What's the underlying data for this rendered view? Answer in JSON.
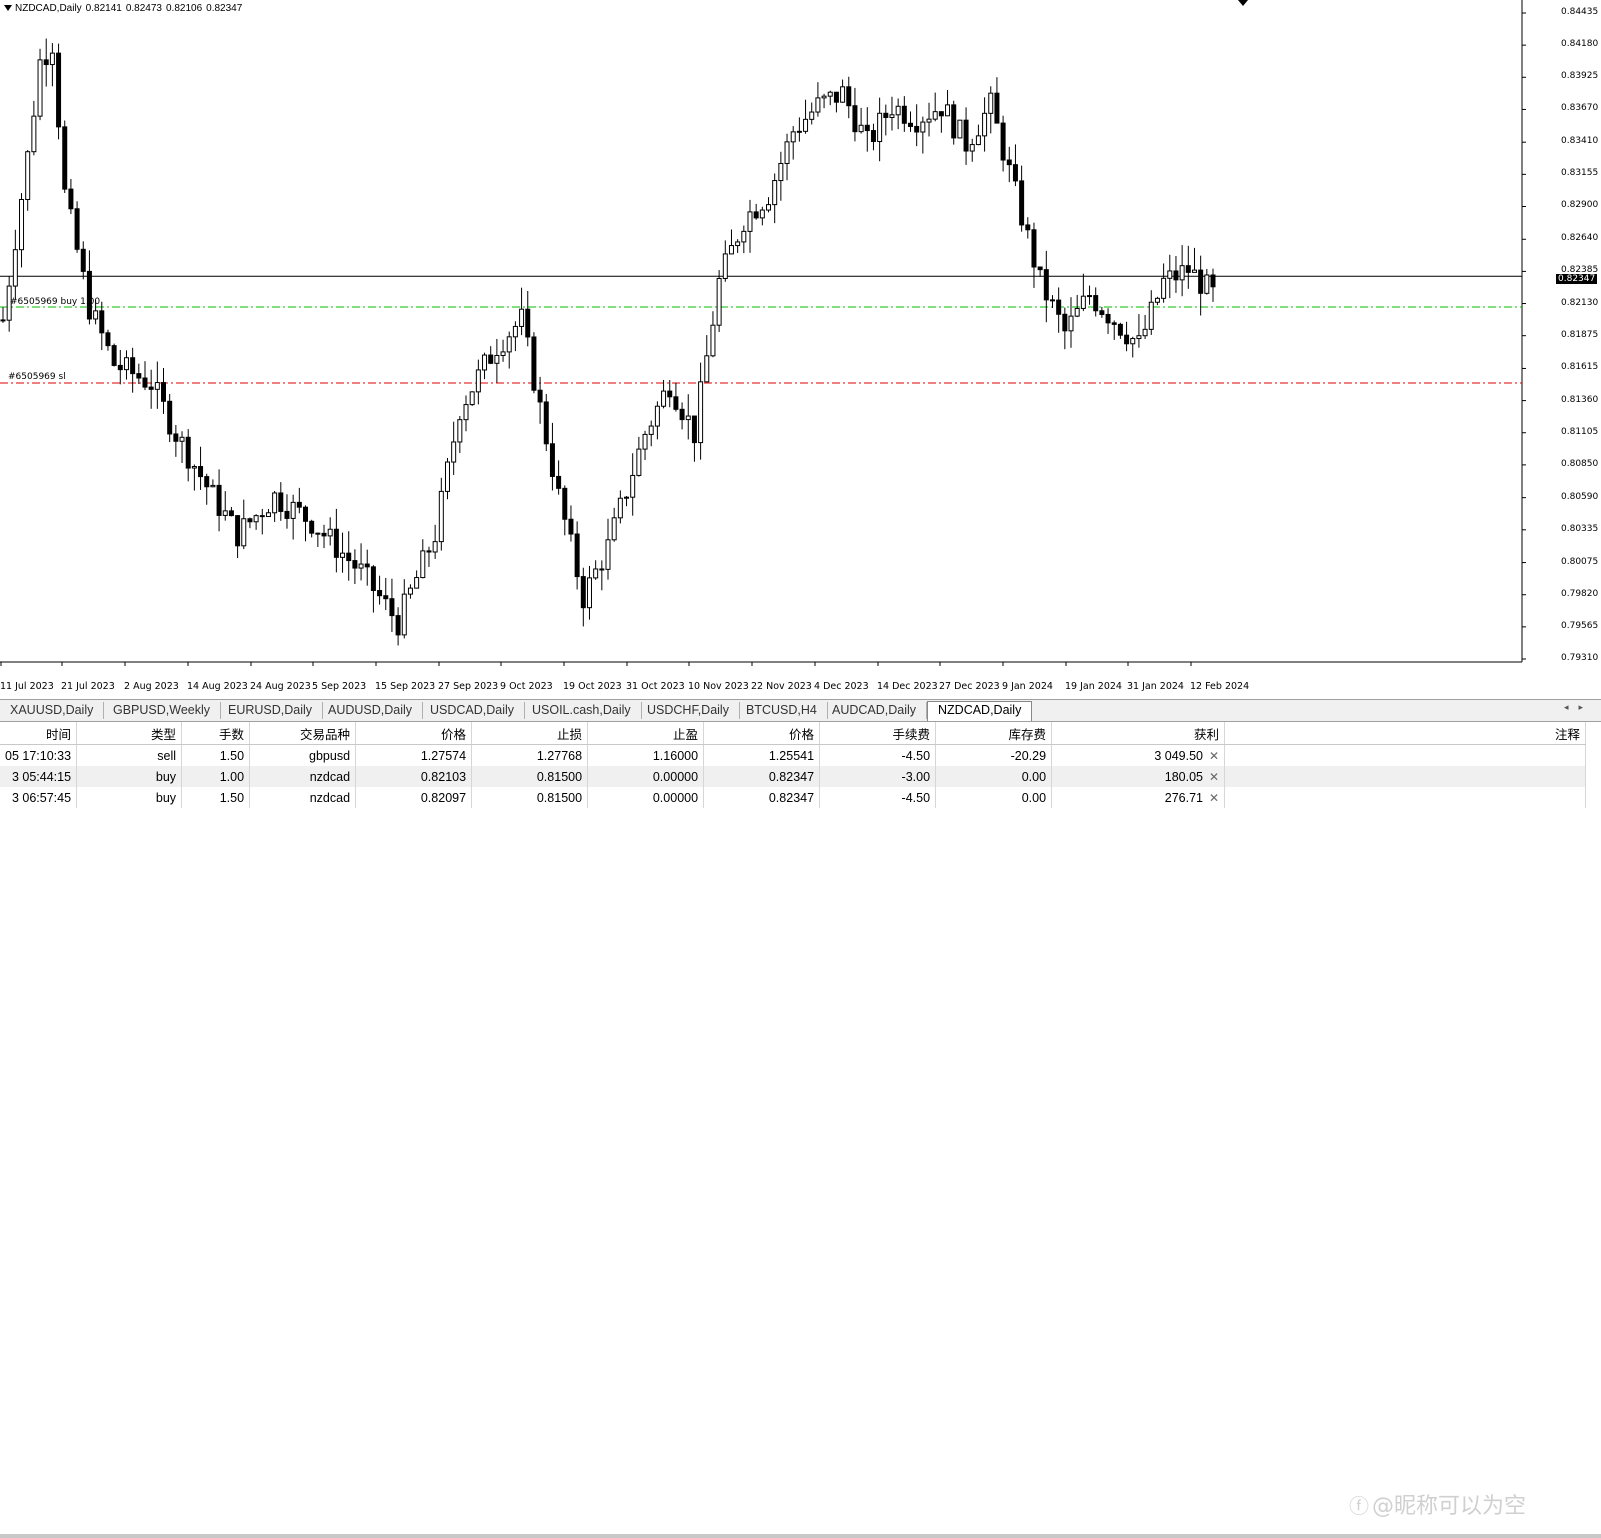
{
  "chart": {
    "symbol": "NZDCAD,Daily",
    "ohlc_readout": [
      "0.82141",
      "0.82473",
      "0.82106",
      "0.82347"
    ],
    "current_price": "0.82347",
    "price_axis": [
      "0.84435",
      "0.84180",
      "0.83925",
      "0.83670",
      "0.83410",
      "0.83155",
      "0.82900",
      "0.82640",
      "0.82385",
      "0.82130",
      "0.81875",
      "0.81615",
      "0.81360",
      "0.81105",
      "0.80850",
      "0.80590",
      "0.80335",
      "0.80075",
      "0.79820",
      "0.79565",
      "0.79310"
    ],
    "date_axis": [
      "11 Jul 2023",
      "21 Jul 2023",
      "2 Aug 2023",
      "14 Aug 2023",
      "24 Aug 2023",
      "5 Sep 2023",
      "15 Sep 2023",
      "27 Sep 2023",
      "9 Oct 2023",
      "19 Oct 2023",
      "31 Oct 2023",
      "10 Nov 2023",
      "22 Nov 2023",
      "4 Dec 2023",
      "14 Dec 2023",
      "27 Dec 2023",
      "9 Jan 2024",
      "19 Jan 2024",
      "31 Jan 2024",
      "12 Feb 2024"
    ],
    "order_labels": {
      "buy": "#6505969 buy 1.00",
      "sl": "#6505969 sl"
    },
    "levels": {
      "current": 0.82347,
      "buy_entry": 0.82103,
      "stop_loss": 0.815
    },
    "colors": {
      "buy_line": "#00c000",
      "sl_line": "#e00000",
      "candle": "#000000"
    }
  },
  "tabs": [
    "XAUUSD,Daily",
    "GBPUSD,Weekly",
    "EURUSD,Daily",
    "AUDUSD,Daily",
    "USDCAD,Daily",
    "USOIL.cash,Daily",
    "USDCHF,Daily",
    "BTCUSD,H4",
    "AUDCAD,Daily",
    "NZDCAD,Daily"
  ],
  "active_tab": "NZDCAD,Daily",
  "terminal": {
    "columns": [
      "时间",
      "类型",
      "手数",
      "交易品种",
      "价格",
      "止损",
      "止盈",
      "价格",
      "手续费",
      "库存费",
      "获利",
      "注释"
    ],
    "rows": [
      [
        "05 17:10:33",
        "sell",
        "1.50",
        "gbpusd",
        "1.27574",
        "1.27768",
        "1.16000",
        "1.25541",
        "-4.50",
        "-20.29",
        "3 049.50",
        ""
      ],
      [
        "3 05:44:15",
        "buy",
        "1.00",
        "nzdcad",
        "0.82103",
        "0.81500",
        "0.00000",
        "0.82347",
        "-3.00",
        "0.00",
        "180.05",
        ""
      ],
      [
        "3 06:57:45",
        "buy",
        "1.50",
        "nzdcad",
        "0.82097",
        "0.81500",
        "0.00000",
        "0.82347",
        "-4.50",
        "0.00",
        "276.71",
        ""
      ]
    ]
  },
  "watermark": "@昵称可以为空"
}
